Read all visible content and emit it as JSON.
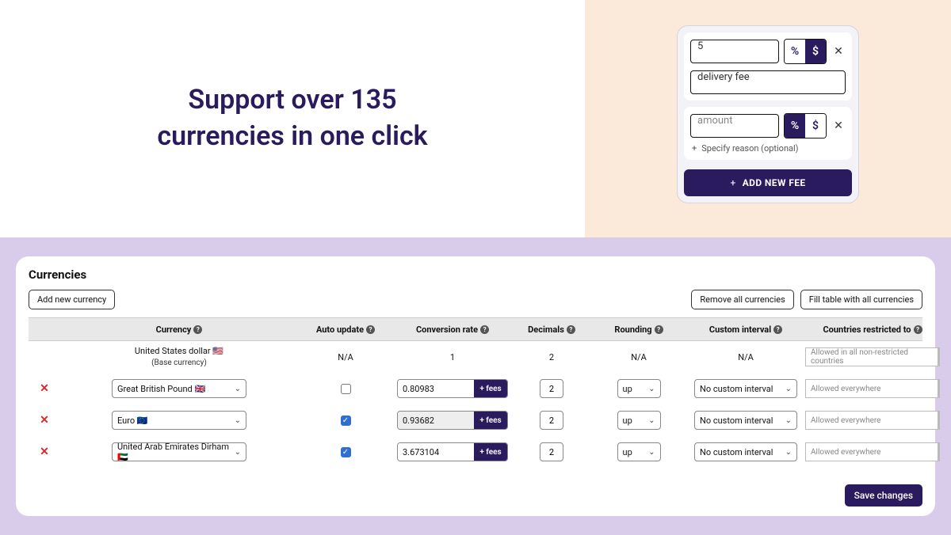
{
  "headline": {
    "line1": "Support over 135",
    "line2": "currencies in one click"
  },
  "feesCard": {
    "fees": [
      {
        "amount": "5",
        "amountIsPlaceholder": false,
        "unit": "$",
        "reason": "delivery fee",
        "showReasonInput": true
      },
      {
        "amount": "amount",
        "amountIsPlaceholder": true,
        "unit": "%",
        "reason": "",
        "showReasonInput": false
      }
    ],
    "unitOptions": [
      "%",
      "$"
    ],
    "specifyReasonLabel": "Specify reason (optional)",
    "addButton": "ADD NEW FEE"
  },
  "currenciesPanel": {
    "title": "Currencies",
    "addButton": "Add new currency",
    "removeAll": "Remove all currencies",
    "fillAll": "Fill table with all currencies",
    "saveButton": "Save changes",
    "columns": {
      "currency": "Currency",
      "autoUpdate": "Auto update",
      "conversionRate": "Conversion rate",
      "decimals": "Decimals",
      "rounding": "Rounding",
      "customInterval": "Custom interval",
      "countries": "Countries restricted to"
    },
    "feesLabel": "+ fees",
    "baseRow": {
      "currency": "United States dollar 🇺🇸",
      "note": "(Base currency)",
      "autoUpdate": "N/A",
      "rate": "1",
      "decimals": "2",
      "rounding": "N/A",
      "customInterval": "N/A",
      "countries": "Allowed in all non-restricted countries"
    },
    "rows": [
      {
        "currency": "Great British Pound 🇬🇧",
        "autoUpdate": false,
        "rate": "0.80983",
        "rateDisabled": false,
        "decimals": "2",
        "rounding": "up",
        "customInterval": "No custom interval",
        "countries": "Allowed everywhere"
      },
      {
        "currency": "Euro 🇪🇺",
        "autoUpdate": true,
        "rate": "0.93682",
        "rateDisabled": true,
        "decimals": "2",
        "rounding": "up",
        "customInterval": "No custom interval",
        "countries": "Allowed everywhere"
      },
      {
        "currency": "United Arab Emirates Dirham 🇦🇪",
        "autoUpdate": true,
        "rate": "3.673104",
        "rateDisabled": false,
        "decimals": "2",
        "rounding": "up",
        "customInterval": "No custom interval",
        "countries": "Allowed everywhere"
      }
    ]
  }
}
